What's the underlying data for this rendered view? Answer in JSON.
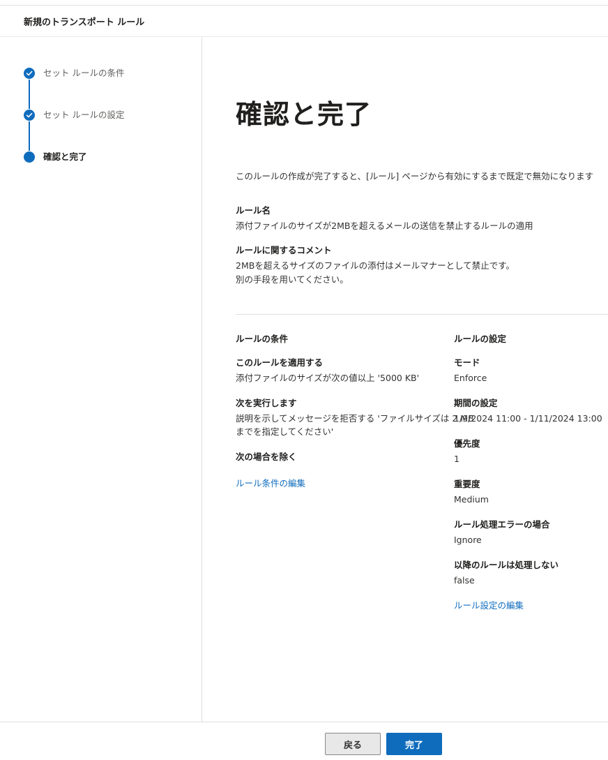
{
  "header": {
    "title": "新規のトランスポート ルール"
  },
  "steps": [
    {
      "label": "セット ルールの条件",
      "state": "completed"
    },
    {
      "label": "セット ルールの設定",
      "state": "completed"
    },
    {
      "label": "確認と完了",
      "state": "current"
    }
  ],
  "main": {
    "title": "確認と完了",
    "intro": "このルールの作成が完了すると、[ルール] ページから有効にするまで既定で無効になります",
    "rule_name_label": "ルール名",
    "rule_name_value": "添付ファイルのサイズが2MBを超えるメールの送信を禁止するルールの適用",
    "comment_label": "ルールに関するコメント",
    "comment_line1": "2MBを超えるサイズのファイルの添付はメールマナーとして禁止です。",
    "comment_line2": "別の手段を用いてください。"
  },
  "conditions": {
    "heading": "ルールの条件",
    "apply_label": "このルールを適用する",
    "apply_value": "添付ファイルのサイズが次の値以上 '5000 KB'",
    "do_label": "次を実行します",
    "do_line1": "説明を示してメッセージを拒否する 'ファイルサイズは 2 MB",
    "do_line2": "までを指定してください'",
    "except_label": "次の場合を除く",
    "edit_link": "ルール条件の編集"
  },
  "settings": {
    "heading": "ルールの設定",
    "mode_label": "モード",
    "mode_value": "Enforce",
    "period_label": "期間の設定",
    "period_value": "1/9/2024 11:00 - 1/11/2024 13:00",
    "priority_label": "優先度",
    "priority_value": "1",
    "severity_label": "重要度",
    "severity_value": "Medium",
    "error_label": "ルール処理エラーの場合",
    "error_value": "Ignore",
    "stop_label": "以降のルールは処理しない",
    "stop_value": "false",
    "edit_link": "ルール設定の編集"
  },
  "footer": {
    "back_label": "戻る",
    "finish_label": "完了"
  },
  "colors": {
    "accent": "#0f6cbd",
    "divider": "#e1dfdd"
  }
}
